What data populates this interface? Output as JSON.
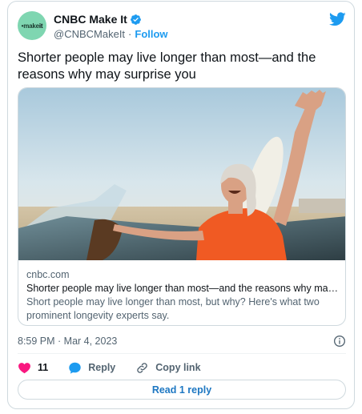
{
  "tweet": {
    "author": {
      "name": "CNBC Make It",
      "handle": "@CNBCMakeIt",
      "avatar_text_pre": "•make",
      "avatar_text_hl": "it"
    },
    "follow_label": "Follow",
    "separator": "·",
    "text": "Shorter people may live longer than most—and the reasons why may surprise you",
    "link_card": {
      "domain": "cnbc.com",
      "title": "Shorter people may live longer than most—and the reasons why may surprise you",
      "description": "Short people may live longer than most, but why? Here's what two prominent longevity experts say."
    },
    "timestamp": "8:59 PM · Mar 4, 2023",
    "likes": "11",
    "reply_label": "Reply",
    "copy_link_label": "Copy link",
    "read_replies_label": "Read 1 reply"
  },
  "colors": {
    "accent": "#1d9bf0",
    "like": "#f91880",
    "avatar_bg": "#7fd6b1"
  },
  "icons": [
    "verified-badge-icon",
    "twitter-bird-icon",
    "info-icon",
    "heart-icon",
    "reply-bubble-icon",
    "link-icon"
  ]
}
